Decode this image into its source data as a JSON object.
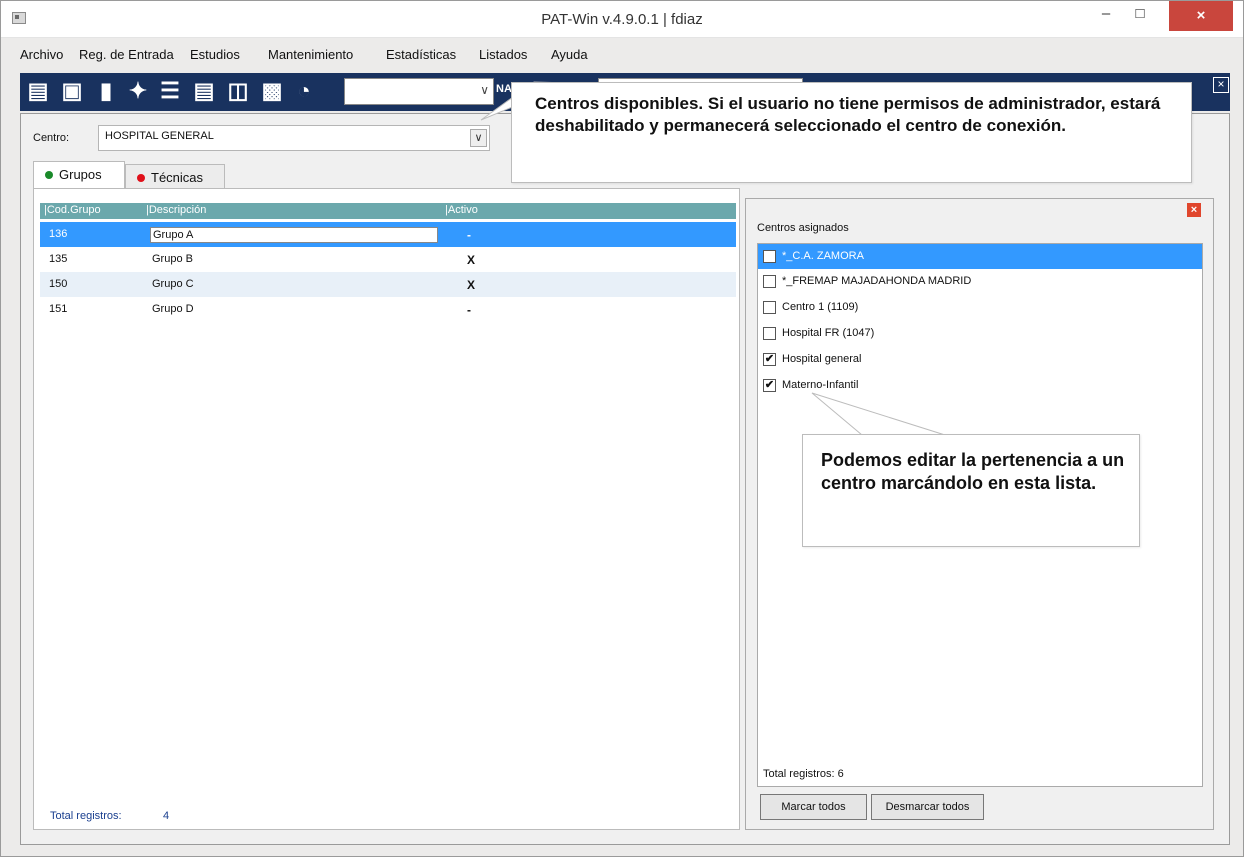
{
  "window": {
    "title": "PAT-Win v.4.9.0.1 | fdiaz",
    "min_glyph": "–",
    "max_glyph": "□",
    "close_glyph": "×"
  },
  "menu": [
    "Archivo",
    "Reg. de Entrada",
    "Estudios",
    "Mantenimiento",
    "Estadísticas",
    "Listados",
    "Ayuda"
  ],
  "toolbar": {
    "na_label": "NA",
    "icons": [
      "save-icon",
      "print-icon",
      "book-icon",
      "tools-icon",
      "list-icon",
      "document-icon",
      "printer-icon",
      "report-icon",
      "pie-chart-icon"
    ],
    "close_glyph": "×"
  },
  "centro": {
    "label": "Centro:",
    "value": "HOSPITAL GENERAL"
  },
  "tabs": [
    {
      "label": "Grupos",
      "dot_color": "#1a8a2a"
    },
    {
      "label": "Técnicas",
      "dot_color": "#e0101a"
    }
  ],
  "grid": {
    "columns": [
      "Cod.Grupo",
      "Descripción",
      "Activo"
    ],
    "rows": [
      {
        "cod": "136",
        "desc": "Grupo A",
        "activo": "-"
      },
      {
        "cod": "135",
        "desc": "Grupo B",
        "activo": "X"
      },
      {
        "cod": "150",
        "desc": "Grupo C",
        "activo": "X"
      },
      {
        "cod": "151",
        "desc": "Grupo D",
        "activo": "-"
      }
    ],
    "total_label": "Total registros:",
    "total_value": "4"
  },
  "centros_asignados": {
    "title": "Centros asignados",
    "items": [
      {
        "label": "*_C.A. ZAMORA",
        "checked": false
      },
      {
        "label": "*_FREMAP MAJADAHONDA MADRID",
        "checked": false
      },
      {
        "label": "Centro 1 (1109)",
        "checked": false
      },
      {
        "label": "Hospital FR (1047)",
        "checked": false
      },
      {
        "label": "Hospital general",
        "checked": true
      },
      {
        "label": "Materno-Infantil",
        "checked": true
      }
    ],
    "total_label": "Total registros:  6",
    "mark_all": "Marcar todos",
    "unmark_all": "Desmarcar todos"
  },
  "callouts": {
    "centro": "Centros disponibles. Si el usuario no tiene permisos de administrador, estará deshabilitado y permanecerá seleccionado el centro de conexión.",
    "lista": "Podemos editar la pertenencia a un centro marcándolo en esta lista."
  }
}
